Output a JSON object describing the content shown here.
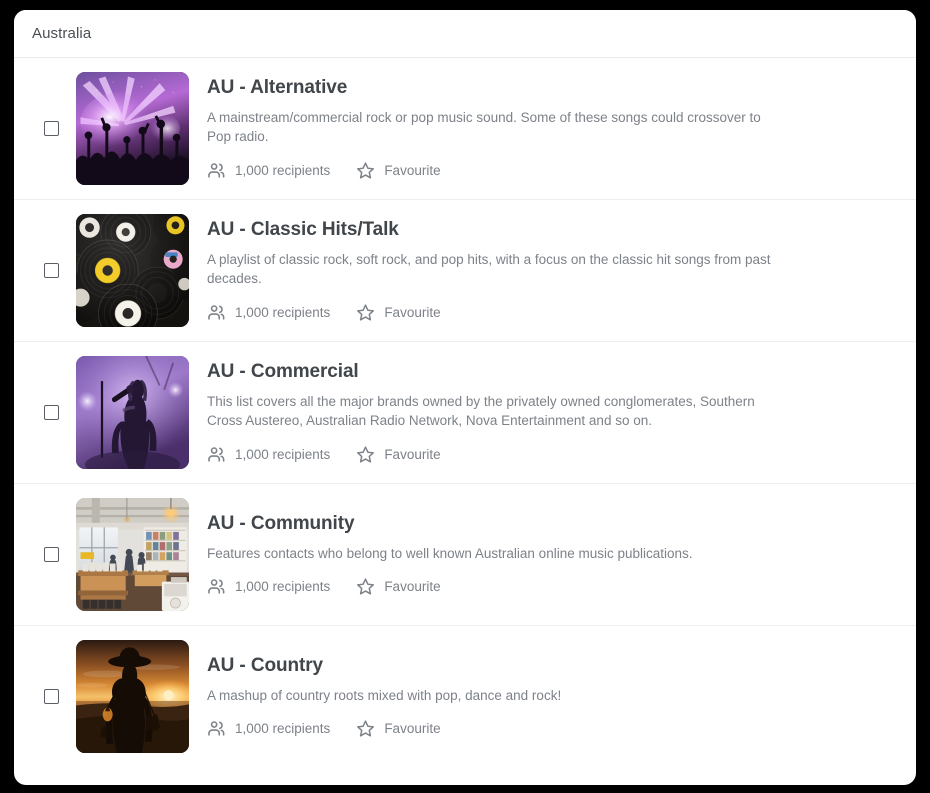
{
  "panel": {
    "title": "Australia"
  },
  "colors": {
    "card_background": "#ffffff",
    "frame": "#000000",
    "title_text": "#4a4f55",
    "item_title_text": "#41464b",
    "muted_text": "#7d8289",
    "divider": "#eceef0",
    "checkbox_border": "#5a5f66"
  },
  "icons": {
    "recipients": "people-icon",
    "favourite": "star-outline-icon",
    "checkbox": "checkbox-icon"
  },
  "labels": {
    "favourite": "Favourite"
  },
  "items": [
    {
      "title": "AU - Alternative",
      "description": "A mainstream/commercial rock or pop music sound. Some of these songs could crossover to Pop radio.",
      "recipients": "1,000 recipients",
      "favourite": "Favourite",
      "checked": false,
      "thumbnail": "concert-crowd-purple-lights"
    },
    {
      "title": "AU - Classic Hits/Talk",
      "description": "A playlist of classic rock, soft rock, and pop hits, with a focus on the classic hit songs from past decades.",
      "recipients": "1,000 recipients",
      "favourite": "Favourite",
      "checked": false,
      "thumbnail": "vinyl-records-stack"
    },
    {
      "title": "AU - Commercial",
      "description": "This list covers all the major brands owned by the privately owned conglomerates, Southern Cross Austereo, Australian Radio Network, Nova Entertainment and so on.",
      "recipients": "1,000 recipients",
      "favourite": "Favourite",
      "checked": false,
      "thumbnail": "singer-purple-stage"
    },
    {
      "title": "AU - Community",
      "description": "Features contacts who belong to well known Australian online music publications.",
      "recipients": "1,000 recipients",
      "favourite": "Favourite",
      "checked": false,
      "thumbnail": "record-store-interior"
    },
    {
      "title": "AU - Country",
      "description": "A mashup of country roots mixed with pop, dance and rock!",
      "recipients": "1,000 recipients",
      "favourite": "Favourite",
      "checked": false,
      "thumbnail": "cowboy-sunset-silhouette"
    }
  ]
}
